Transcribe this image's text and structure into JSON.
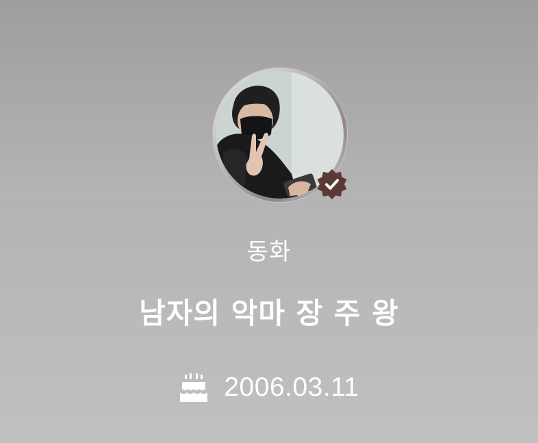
{
  "profile": {
    "display_name": "동화",
    "status_message": "남자의 악마 장 주 왕",
    "birthday": "2006.03.11",
    "verified": true
  },
  "icons": {
    "avatar": "profile-photo",
    "badge": "verified-badge-icon",
    "birthday": "birthday-cake-icon"
  },
  "colors": {
    "text": "#ffffff",
    "badge": "#5a3b33",
    "background_top": "#9e9e9e",
    "background_bottom": "#c0c0c0"
  }
}
